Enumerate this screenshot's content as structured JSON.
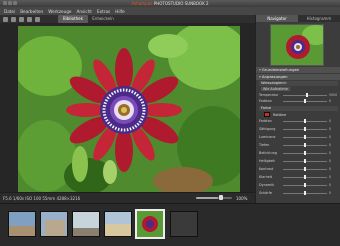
{
  "window": {
    "title_brand": "Ashampoo",
    "title_rest": "PHOTOSTUDIO SUNBOOK 2"
  },
  "menu": [
    "Datei",
    "Bearbeiten",
    "Werkzeuge",
    "Ansicht",
    "Extras",
    "Hilfe"
  ],
  "tabs": [
    "Bibliothek",
    "Entwickeln"
  ],
  "active_tab": "Bibliothek",
  "right_tabs": [
    "Navigator",
    "Histogramm"
  ],
  "panels": {
    "basic": {
      "title": "Grundeinstellungen"
    },
    "color": {
      "title": "Farbe"
    },
    "adjust": {
      "title": "Anpassungen",
      "wb_title": "Weissabgleich",
      "wb_value": "Wie Aufnahme"
    },
    "sliders_top": [
      {
        "label": "Temperatur",
        "value": "5000",
        "pos": 0.55
      },
      {
        "label": "Farbton",
        "value": "0",
        "pos": 0.5
      }
    ],
    "swatch_label": "Rottöne",
    "sliders_bottom": [
      {
        "label": "Farbton",
        "value": "0",
        "pos": 0.5
      },
      {
        "label": "Sättigung",
        "value": "0",
        "pos": 0.5
      },
      {
        "label": "Luminanz",
        "value": "0",
        "pos": 0.5
      },
      {
        "label": "Tiefen",
        "value": "0",
        "pos": 0.5
      },
      {
        "label": "Belichtung",
        "value": "0",
        "pos": 0.5
      },
      {
        "label": "Helligkeit",
        "value": "0",
        "pos": 0.5
      },
      {
        "label": "Kontrast",
        "value": "0",
        "pos": 0.5
      },
      {
        "label": "Klarheit",
        "value": "0",
        "pos": 0.5
      },
      {
        "label": "Dynamik",
        "value": "0",
        "pos": 0.5
      },
      {
        "label": "Schärfe",
        "value": "0",
        "pos": 0.5
      }
    ]
  },
  "status": {
    "info": "F5.6 1/60s ISO 100 55mm 4288×3216",
    "zoom": "100%",
    "zoom_level": 0.6
  },
  "filmstrip_count": 6
}
